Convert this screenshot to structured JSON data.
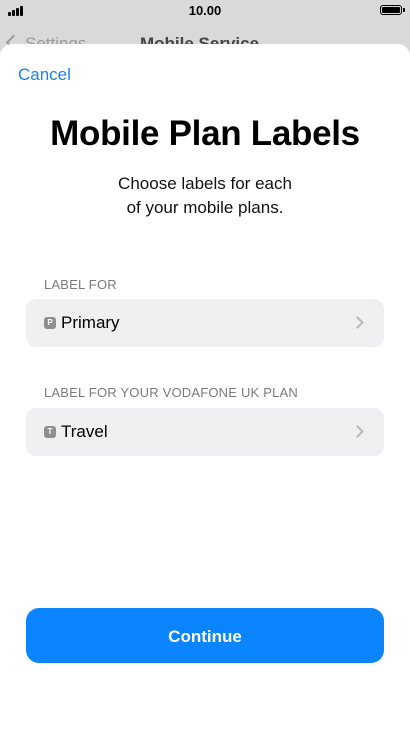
{
  "status_bar": {
    "time": "10.00"
  },
  "background_nav": {
    "back_label": "Settings",
    "title": "Mobile Service"
  },
  "sheet": {
    "cancel_label": "Cancel",
    "title": "Mobile Plan Labels",
    "subtitle_line1": "Choose labels for each",
    "subtitle_line2": "of your mobile plans."
  },
  "plans": [
    {
      "section_label": "LABEL FOR",
      "badge": "P",
      "label": "Primary",
      "icon": "chevron-right-icon"
    },
    {
      "section_label": "LABEL FOR YOUR VODAFONE UK PLAN",
      "badge": "T",
      "label": "Travel",
      "icon": "chevron-right-icon"
    }
  ],
  "continue_label": "Continue",
  "colors": {
    "accent": "#0a84ff",
    "link": "#1a82ea",
    "row_background": "#f0f0f2",
    "badge": "#8e8e93"
  }
}
